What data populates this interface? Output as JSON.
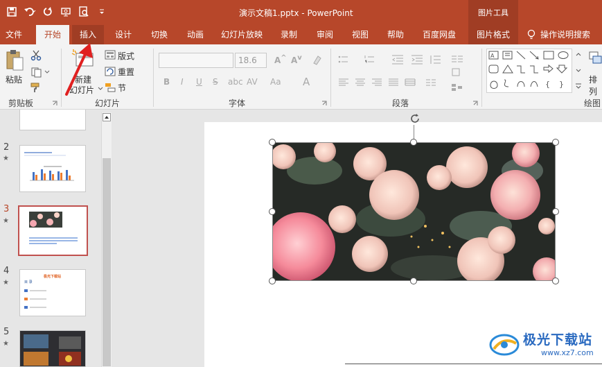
{
  "titlebar": {
    "document_title": "演示文稿1.pptx - PowerPoint",
    "context_tools": "图片工具"
  },
  "tabs": [
    "文件",
    "开始",
    "插入",
    "设计",
    "切换",
    "动画",
    "幻灯片放映",
    "录制",
    "审阅",
    "视图",
    "帮助",
    "百度网盘",
    "图片格式"
  ],
  "tell_me": "操作说明搜索",
  "ribbon": {
    "paste": "粘贴",
    "new_slide_line1": "新建",
    "new_slide_line2": "幻灯片",
    "layout": "版式",
    "reset": "重置",
    "section": "节",
    "font_size": "18.6",
    "arrange": "排列",
    "groups": {
      "clipboard": "剪贴板",
      "slides": "幻灯片",
      "font": "字体",
      "paragraph": "段落",
      "drawing": "绘图"
    }
  },
  "slides": [
    {
      "num": "2",
      "star": "★"
    },
    {
      "num": "3",
      "star": "★"
    },
    {
      "num": "4",
      "star": "★",
      "thumb_title": "极光下载站",
      "thumb_heading": "目 录"
    },
    {
      "num": "5",
      "star": "★"
    }
  ],
  "watermark": {
    "name": "极光下载站",
    "url": "www.xz7.com"
  },
  "colors": {
    "accent": "#b7472a",
    "context_tab": "#a03d24",
    "arrow": "#e02020"
  }
}
